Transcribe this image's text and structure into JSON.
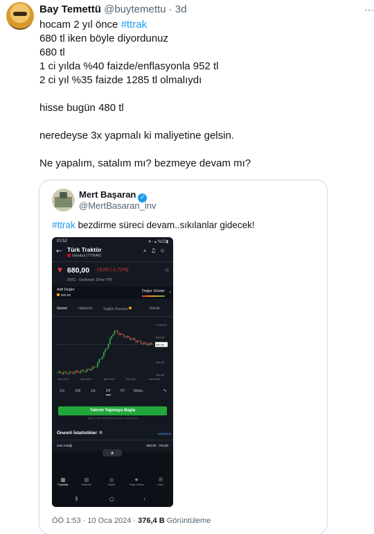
{
  "tweet": {
    "author_name": "Bay Temettü",
    "author_handle": "@buytemettu",
    "separator": "·",
    "time": "3d",
    "lines": [
      {
        "prefix": "hocam 2 yıl önce ",
        "hashtag": "#ttrak"
      },
      {
        "text": "680 tl iken böyle diyordunuz"
      },
      {
        "text": "680 tl"
      },
      {
        "text": "1 ci yılda %40 faizde/enflasyonla 952 tl"
      },
      {
        "text": "2 ci yıl %35 faizde 1285 tl olmalıydı"
      },
      {
        "text": ""
      },
      {
        "text": "hisse bugün 480 tl"
      },
      {
        "text": ""
      },
      {
        "text": "neredeyse 3x yapmalı ki maliyetine gelsin."
      },
      {
        "text": ""
      },
      {
        "text": "Ne yapalım, satalım mı? bezmeye devam mı?"
      }
    ]
  },
  "quote": {
    "author_name": "Mert Başaran",
    "author_handle": "@MertBasaran_inv",
    "verified_glyph": "✓",
    "hashtag": "#ttrak",
    "text": " bezdirme süreci devam..sıkılanlar gidecek!",
    "footer_time": "ÖÖ 1:53 · 10 Oca 2024 · ",
    "footer_views": "376,4 B",
    "footer_views_label": " Görüntüleme"
  },
  "app": {
    "status_time": "01:52",
    "status_right": "▾ ◦ ▴ %22▮",
    "title": "Türk Traktör",
    "subtitle": "İstanbul (TTRAK)",
    "price": "680,00",
    "change": "-19,00 (-2,72%)",
    "date_line": "09/01 · Gecikmeli. Döviz TRY",
    "ratio_label": "Adil Değer",
    "ratio_value": "xxx,xx",
    "ratio_button": "Değer Göster",
    "tabs": [
      "Genel",
      "Haberler",
      "Sağlık Durumu",
      "Teknik"
    ],
    "chart_y_labels": [
      "1.000,00",
      "800,00",
      "680,00",
      "400,00",
      "200,00"
    ],
    "chart_x_labels": [
      "Şub 2023",
      "Ner 2023",
      "Tem 2023",
      "Eyl 2023",
      "Kas 2023"
    ],
    "ranges": [
      "1G",
      "1W",
      "1A",
      "1Y",
      "5Y",
      "Maks."
    ],
    "active_range": "1Y",
    "invest_button": "Yatırım Yapmaya Başla",
    "disclaimer": "Reklam | 2023 - Bu Platform'da Yatırım Yapmak Riskli",
    "stats_title": "Önemli İstatistikler",
    "edit_label": "DÜZENLE",
    "day_range_label": "Gün Aralığı",
    "day_range_value": "680,00 - 703,00",
    "nav": [
      "Piyasalar",
      "Haberler",
      "Küçük",
      "Takip Listesi",
      "Daha"
    ],
    "icons": {
      "back": "arrow-left-icon",
      "search": "search-icon",
      "alert": "bell-plus-icon",
      "star": "star-icon",
      "share": "share-icon",
      "down": "arrow-down-icon",
      "chevron": "chevron-right-icon",
      "line_chart": "line-chart-icon",
      "info": "info-icon",
      "handle": "chevron-up-icon"
    },
    "colors": {
      "up": "#36b44a",
      "down": "#e0393e",
      "accent": "#22a73a",
      "link": "#1d9bf0"
    }
  },
  "chart_data": {
    "type": "line",
    "x": [
      "Şub 2023",
      "Ner 2023",
      "Tem 2023",
      "Eyl 2023",
      "Kas 2023"
    ],
    "y_ticks": [
      1000,
      800,
      680,
      400,
      200
    ],
    "series": [
      {
        "values": [
          230,
          225,
          240,
          260,
          320,
          560,
          900,
          820,
          760,
          700,
          680
        ]
      }
    ],
    "last_value": 680,
    "ylim": [
      200,
      1000
    ],
    "grid": true
  }
}
